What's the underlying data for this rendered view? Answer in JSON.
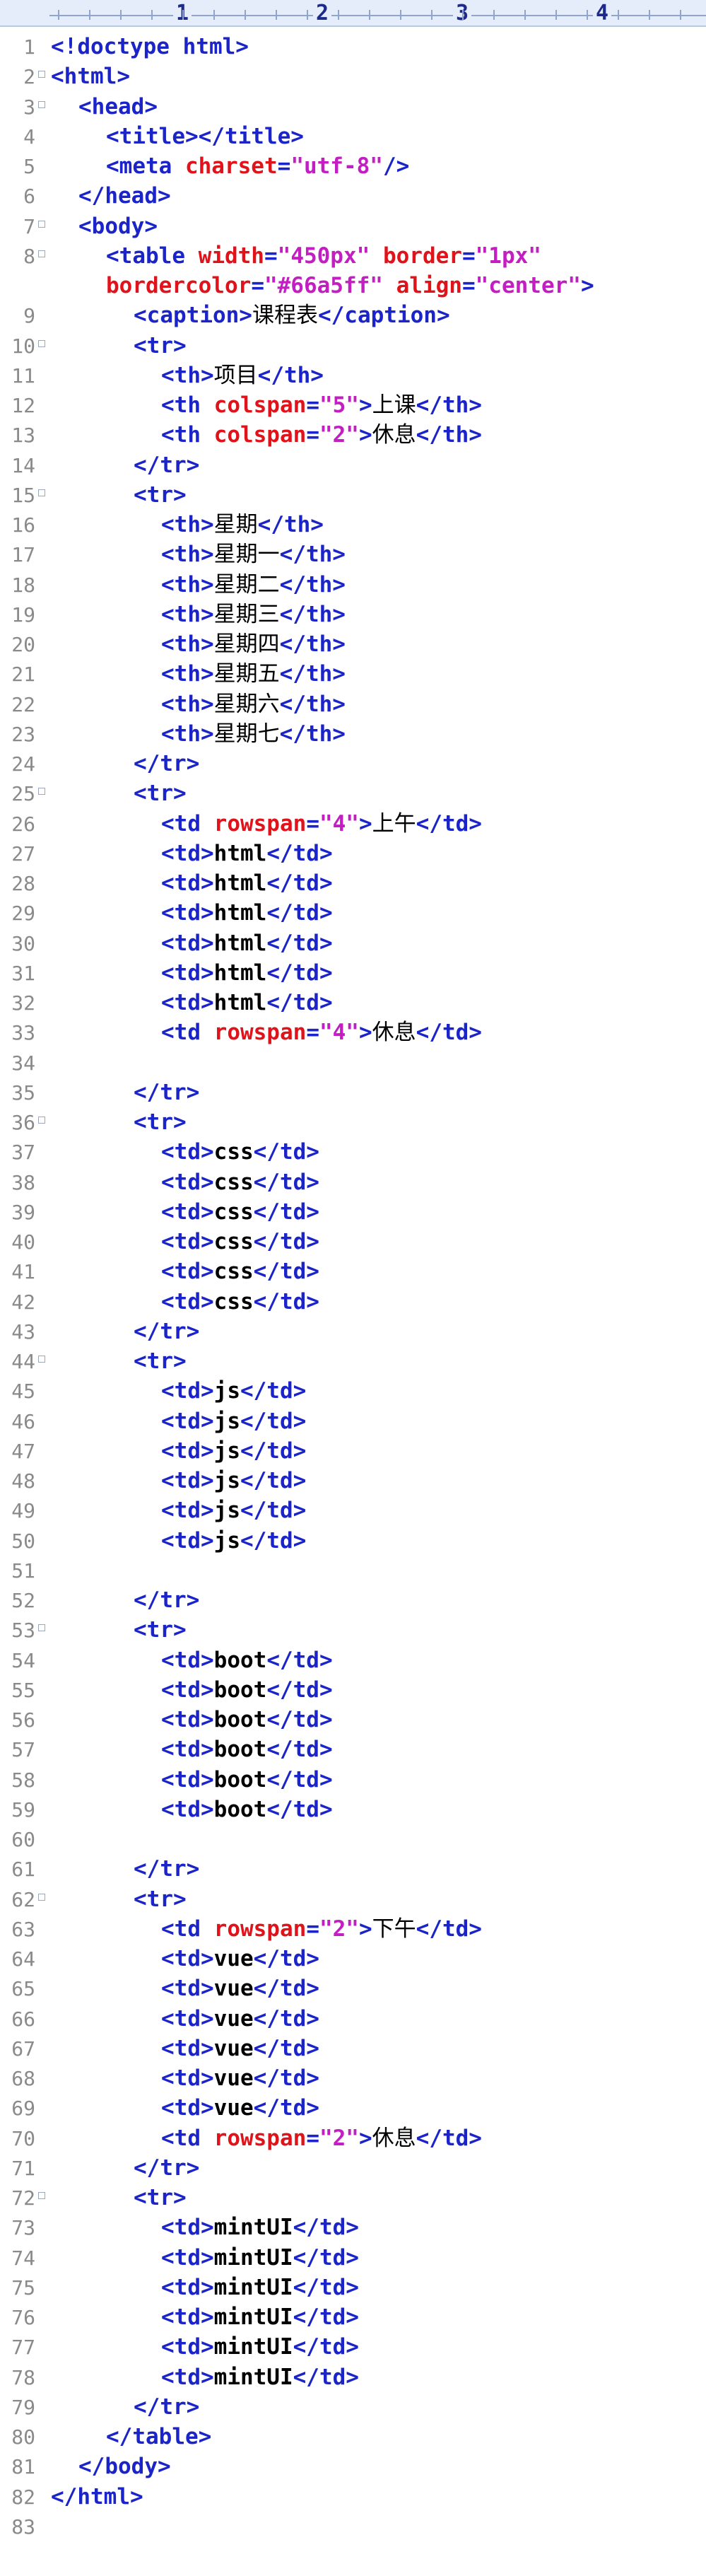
{
  "ruler": {
    "numbers": [
      "1",
      "2",
      "3",
      "4"
    ]
  },
  "lines": [
    {
      "n": "1",
      "indent": 0,
      "parts": [
        [
          "tag",
          "<!doctype "
        ],
        [
          "doc",
          "html"
        ],
        [
          "tag",
          ">"
        ]
      ]
    },
    {
      "n": "2",
      "indent": 0,
      "fold": true,
      "parts": [
        [
          "tag",
          "<html>"
        ]
      ]
    },
    {
      "n": "3",
      "indent": 1,
      "fold": true,
      "parts": [
        [
          "tag",
          "<head>"
        ]
      ]
    },
    {
      "n": "4",
      "indent": 2,
      "parts": [
        [
          "tag",
          "<title></title>"
        ]
      ]
    },
    {
      "n": "5",
      "indent": 2,
      "parts": [
        [
          "tag",
          "<meta "
        ],
        [
          "attr",
          "charset"
        ],
        [
          "tag",
          "="
        ],
        [
          "val",
          "\"utf-8\""
        ],
        [
          "tag",
          "/>"
        ]
      ]
    },
    {
      "n": "6",
      "indent": 1,
      "parts": [
        [
          "tag",
          "</head>"
        ]
      ]
    },
    {
      "n": "7",
      "indent": 1,
      "fold": true,
      "parts": [
        [
          "tag",
          "<body>"
        ]
      ]
    },
    {
      "n": "8",
      "indent": 2,
      "fold": true,
      "parts": [
        [
          "tag",
          "<table "
        ],
        [
          "attr",
          "width"
        ],
        [
          "tag",
          "="
        ],
        [
          "val",
          "\"450px\""
        ],
        [
          "tag",
          " "
        ],
        [
          "attr",
          "border"
        ],
        [
          "tag",
          "="
        ],
        [
          "val",
          "\"1px\""
        ]
      ]
    },
    {
      "n": "",
      "indent": 2,
      "parts": [
        [
          "attr",
          "bordercolor"
        ],
        [
          "tag",
          "="
        ],
        [
          "val",
          "\"#66a5ff\""
        ],
        [
          "tag",
          " "
        ],
        [
          "attr",
          "align"
        ],
        [
          "tag",
          "="
        ],
        [
          "val",
          "\"center\""
        ],
        [
          "tag",
          ">"
        ]
      ]
    },
    {
      "n": "9",
      "indent": 3,
      "parts": [
        [
          "tag",
          "<caption>"
        ],
        [
          "txt",
          "课程表"
        ],
        [
          "tag",
          "</caption>"
        ]
      ]
    },
    {
      "n": "10",
      "indent": 3,
      "fold": true,
      "parts": [
        [
          "tag",
          "<tr>"
        ]
      ]
    },
    {
      "n": "11",
      "indent": 4,
      "parts": [
        [
          "tag",
          "<th>"
        ],
        [
          "txt",
          "项目"
        ],
        [
          "tag",
          "</th>"
        ]
      ]
    },
    {
      "n": "12",
      "indent": 4,
      "parts": [
        [
          "tag",
          "<th "
        ],
        [
          "attr",
          "colspan"
        ],
        [
          "tag",
          "="
        ],
        [
          "val",
          "\"5\""
        ],
        [
          "tag",
          ">"
        ],
        [
          "txt",
          "上课"
        ],
        [
          "tag",
          "</th>"
        ]
      ]
    },
    {
      "n": "13",
      "indent": 4,
      "parts": [
        [
          "tag",
          "<th "
        ],
        [
          "attr",
          "colspan"
        ],
        [
          "tag",
          "="
        ],
        [
          "val",
          "\"2\""
        ],
        [
          "tag",
          ">"
        ],
        [
          "txt",
          "休息"
        ],
        [
          "tag",
          "</th>"
        ]
      ]
    },
    {
      "n": "14",
      "indent": 3,
      "parts": [
        [
          "tag",
          "</tr>"
        ]
      ]
    },
    {
      "n": "15",
      "indent": 3,
      "fold": true,
      "parts": [
        [
          "tag",
          "<tr>"
        ]
      ]
    },
    {
      "n": "16",
      "indent": 4,
      "parts": [
        [
          "tag",
          "<th>"
        ],
        [
          "txt",
          "星期"
        ],
        [
          "tag",
          "</th>"
        ]
      ]
    },
    {
      "n": "17",
      "indent": 4,
      "parts": [
        [
          "tag",
          "<th>"
        ],
        [
          "txt",
          "星期一"
        ],
        [
          "tag",
          "</th>"
        ]
      ]
    },
    {
      "n": "18",
      "indent": 4,
      "parts": [
        [
          "tag",
          "<th>"
        ],
        [
          "txt",
          "星期二"
        ],
        [
          "tag",
          "</th>"
        ]
      ]
    },
    {
      "n": "19",
      "indent": 4,
      "parts": [
        [
          "tag",
          "<th>"
        ],
        [
          "txt",
          "星期三"
        ],
        [
          "tag",
          "</th>"
        ]
      ]
    },
    {
      "n": "20",
      "indent": 4,
      "parts": [
        [
          "tag",
          "<th>"
        ],
        [
          "txt",
          "星期四"
        ],
        [
          "tag",
          "</th>"
        ]
      ]
    },
    {
      "n": "21",
      "indent": 4,
      "parts": [
        [
          "tag",
          "<th>"
        ],
        [
          "txt",
          "星期五"
        ],
        [
          "tag",
          "</th>"
        ]
      ]
    },
    {
      "n": "22",
      "indent": 4,
      "parts": [
        [
          "tag",
          "<th>"
        ],
        [
          "txt",
          "星期六"
        ],
        [
          "tag",
          "</th>"
        ]
      ]
    },
    {
      "n": "23",
      "indent": 4,
      "parts": [
        [
          "tag",
          "<th>"
        ],
        [
          "txt",
          "星期七"
        ],
        [
          "tag",
          "</th>"
        ]
      ]
    },
    {
      "n": "24",
      "indent": 3,
      "parts": [
        [
          "tag",
          "</tr>"
        ]
      ]
    },
    {
      "n": "25",
      "indent": 3,
      "fold": true,
      "parts": [
        [
          "tag",
          "<tr>"
        ]
      ]
    },
    {
      "n": "26",
      "indent": 4,
      "parts": [
        [
          "tag",
          "<td "
        ],
        [
          "attr",
          "rowspan"
        ],
        [
          "tag",
          "="
        ],
        [
          "val",
          "\"4\""
        ],
        [
          "tag",
          ">"
        ],
        [
          "txt",
          "上午"
        ],
        [
          "tag",
          "</td>"
        ]
      ]
    },
    {
      "n": "27",
      "indent": 4,
      "parts": [
        [
          "tag",
          "<td>"
        ],
        [
          "txtm",
          "html"
        ],
        [
          "tag",
          "</td>"
        ]
      ]
    },
    {
      "n": "28",
      "indent": 4,
      "parts": [
        [
          "tag",
          "<td>"
        ],
        [
          "txtm",
          "html"
        ],
        [
          "tag",
          "</td>"
        ]
      ]
    },
    {
      "n": "29",
      "indent": 4,
      "parts": [
        [
          "tag",
          "<td>"
        ],
        [
          "txtm",
          "html"
        ],
        [
          "tag",
          "</td>"
        ]
      ]
    },
    {
      "n": "30",
      "indent": 4,
      "parts": [
        [
          "tag",
          "<td>"
        ],
        [
          "txtm",
          "html"
        ],
        [
          "tag",
          "</td>"
        ]
      ]
    },
    {
      "n": "31",
      "indent": 4,
      "parts": [
        [
          "tag",
          "<td>"
        ],
        [
          "txtm",
          "html"
        ],
        [
          "tag",
          "</td>"
        ]
      ]
    },
    {
      "n": "32",
      "indent": 4,
      "parts": [
        [
          "tag",
          "<td>"
        ],
        [
          "txtm",
          "html"
        ],
        [
          "tag",
          "</td>"
        ]
      ]
    },
    {
      "n": "33",
      "indent": 4,
      "parts": [
        [
          "tag",
          "<td "
        ],
        [
          "attr",
          "rowspan"
        ],
        [
          "tag",
          "="
        ],
        [
          "val",
          "\"4\""
        ],
        [
          "tag",
          ">"
        ],
        [
          "txt",
          "休息"
        ],
        [
          "tag",
          "</td>"
        ]
      ]
    },
    {
      "n": "34",
      "indent": 0,
      "parts": []
    },
    {
      "n": "35",
      "indent": 3,
      "parts": [
        [
          "tag",
          "</tr>"
        ]
      ]
    },
    {
      "n": "36",
      "indent": 3,
      "fold": true,
      "parts": [
        [
          "tag",
          "<tr>"
        ]
      ]
    },
    {
      "n": "37",
      "indent": 4,
      "parts": [
        [
          "tag",
          "<td>"
        ],
        [
          "txtm",
          "css"
        ],
        [
          "tag",
          "</td>"
        ]
      ]
    },
    {
      "n": "38",
      "indent": 4,
      "parts": [
        [
          "tag",
          "<td>"
        ],
        [
          "txtm",
          "css"
        ],
        [
          "tag",
          "</td>"
        ]
      ]
    },
    {
      "n": "39",
      "indent": 4,
      "parts": [
        [
          "tag",
          "<td>"
        ],
        [
          "txtm",
          "css"
        ],
        [
          "tag",
          "</td>"
        ]
      ]
    },
    {
      "n": "40",
      "indent": 4,
      "parts": [
        [
          "tag",
          "<td>"
        ],
        [
          "txtm",
          "css"
        ],
        [
          "tag",
          "</td>"
        ]
      ]
    },
    {
      "n": "41",
      "indent": 4,
      "parts": [
        [
          "tag",
          "<td>"
        ],
        [
          "txtm",
          "css"
        ],
        [
          "tag",
          "</td>"
        ]
      ]
    },
    {
      "n": "42",
      "indent": 4,
      "parts": [
        [
          "tag",
          "<td>"
        ],
        [
          "txtm",
          "css"
        ],
        [
          "tag",
          "</td>"
        ]
      ]
    },
    {
      "n": "43",
      "indent": 3,
      "parts": [
        [
          "tag",
          "</tr>"
        ]
      ]
    },
    {
      "n": "44",
      "indent": 3,
      "fold": true,
      "parts": [
        [
          "tag",
          "<tr>"
        ]
      ]
    },
    {
      "n": "45",
      "indent": 4,
      "parts": [
        [
          "tag",
          "<td>"
        ],
        [
          "txtm",
          "js"
        ],
        [
          "tag",
          "</td>"
        ]
      ]
    },
    {
      "n": "46",
      "indent": 4,
      "parts": [
        [
          "tag",
          "<td>"
        ],
        [
          "txtm",
          "js"
        ],
        [
          "tag",
          "</td>"
        ]
      ]
    },
    {
      "n": "47",
      "indent": 4,
      "parts": [
        [
          "tag",
          "<td>"
        ],
        [
          "txtm",
          "js"
        ],
        [
          "tag",
          "</td>"
        ]
      ]
    },
    {
      "n": "48",
      "indent": 4,
      "parts": [
        [
          "tag",
          "<td>"
        ],
        [
          "txtm",
          "js"
        ],
        [
          "tag",
          "</td>"
        ]
      ]
    },
    {
      "n": "49",
      "indent": 4,
      "parts": [
        [
          "tag",
          "<td>"
        ],
        [
          "txtm",
          "js"
        ],
        [
          "tag",
          "</td>"
        ]
      ]
    },
    {
      "n": "50",
      "indent": 4,
      "parts": [
        [
          "tag",
          "<td>"
        ],
        [
          "txtm",
          "js"
        ],
        [
          "tag",
          "</td>"
        ]
      ]
    },
    {
      "n": "51",
      "indent": 0,
      "parts": []
    },
    {
      "n": "52",
      "indent": 3,
      "parts": [
        [
          "tag",
          "</tr>"
        ]
      ]
    },
    {
      "n": "53",
      "indent": 3,
      "fold": true,
      "parts": [
        [
          "tag",
          "<tr>"
        ]
      ]
    },
    {
      "n": "54",
      "indent": 4,
      "parts": [
        [
          "tag",
          "<td>"
        ],
        [
          "txtm",
          "boot"
        ],
        [
          "tag",
          "</td>"
        ]
      ]
    },
    {
      "n": "55",
      "indent": 4,
      "parts": [
        [
          "tag",
          "<td>"
        ],
        [
          "txtm",
          "boot"
        ],
        [
          "tag",
          "</td>"
        ]
      ]
    },
    {
      "n": "56",
      "indent": 4,
      "parts": [
        [
          "tag",
          "<td>"
        ],
        [
          "txtm",
          "boot"
        ],
        [
          "tag",
          "</td>"
        ]
      ]
    },
    {
      "n": "57",
      "indent": 4,
      "parts": [
        [
          "tag",
          "<td>"
        ],
        [
          "txtm",
          "boot"
        ],
        [
          "tag",
          "</td>"
        ]
      ]
    },
    {
      "n": "58",
      "indent": 4,
      "parts": [
        [
          "tag",
          "<td>"
        ],
        [
          "txtm",
          "boot"
        ],
        [
          "tag",
          "</td>"
        ]
      ]
    },
    {
      "n": "59",
      "indent": 4,
      "parts": [
        [
          "tag",
          "<td>"
        ],
        [
          "txtm",
          "boot"
        ],
        [
          "tag",
          "</td>"
        ]
      ]
    },
    {
      "n": "60",
      "indent": 0,
      "parts": []
    },
    {
      "n": "61",
      "indent": 3,
      "parts": [
        [
          "tag",
          "</tr>"
        ]
      ]
    },
    {
      "n": "62",
      "indent": 3,
      "fold": true,
      "parts": [
        [
          "tag",
          "<tr>"
        ]
      ]
    },
    {
      "n": "63",
      "indent": 4,
      "parts": [
        [
          "tag",
          "<td "
        ],
        [
          "attr",
          "rowspan"
        ],
        [
          "tag",
          "="
        ],
        [
          "val",
          "\"2\""
        ],
        [
          "tag",
          ">"
        ],
        [
          "txt",
          "下午"
        ],
        [
          "tag",
          "</td>"
        ]
      ]
    },
    {
      "n": "64",
      "indent": 4,
      "parts": [
        [
          "tag",
          "<td>"
        ],
        [
          "txtm",
          "vue"
        ],
        [
          "tag",
          "</td>"
        ]
      ]
    },
    {
      "n": "65",
      "indent": 4,
      "parts": [
        [
          "tag",
          "<td>"
        ],
        [
          "txtm",
          "vue"
        ],
        [
          "tag",
          "</td>"
        ]
      ]
    },
    {
      "n": "66",
      "indent": 4,
      "parts": [
        [
          "tag",
          "<td>"
        ],
        [
          "txtm",
          "vue"
        ],
        [
          "tag",
          "</td>"
        ]
      ]
    },
    {
      "n": "67",
      "indent": 4,
      "parts": [
        [
          "tag",
          "<td>"
        ],
        [
          "txtm",
          "vue"
        ],
        [
          "tag",
          "</td>"
        ]
      ]
    },
    {
      "n": "68",
      "indent": 4,
      "parts": [
        [
          "tag",
          "<td>"
        ],
        [
          "txtm",
          "vue"
        ],
        [
          "tag",
          "</td>"
        ]
      ]
    },
    {
      "n": "69",
      "indent": 4,
      "parts": [
        [
          "tag",
          "<td>"
        ],
        [
          "txtm",
          "vue"
        ],
        [
          "tag",
          "</td>"
        ]
      ]
    },
    {
      "n": "70",
      "indent": 4,
      "parts": [
        [
          "tag",
          "<td "
        ],
        [
          "attr",
          "rowspan"
        ],
        [
          "tag",
          "="
        ],
        [
          "val",
          "\"2\""
        ],
        [
          "tag",
          ">"
        ],
        [
          "txt",
          "休息"
        ],
        [
          "tag",
          "</td>"
        ]
      ]
    },
    {
      "n": "71",
      "indent": 3,
      "parts": [
        [
          "tag",
          "</tr>"
        ]
      ]
    },
    {
      "n": "72",
      "indent": 3,
      "fold": true,
      "parts": [
        [
          "tag",
          "<tr>"
        ]
      ]
    },
    {
      "n": "73",
      "indent": 4,
      "parts": [
        [
          "tag",
          "<td>"
        ],
        [
          "txtm",
          "mintUI"
        ],
        [
          "tag",
          "</td>"
        ]
      ]
    },
    {
      "n": "74",
      "indent": 4,
      "parts": [
        [
          "tag",
          "<td>"
        ],
        [
          "txtm",
          "mintUI"
        ],
        [
          "tag",
          "</td>"
        ]
      ]
    },
    {
      "n": "75",
      "indent": 4,
      "parts": [
        [
          "tag",
          "<td>"
        ],
        [
          "txtm",
          "mintUI"
        ],
        [
          "tag",
          "</td>"
        ]
      ]
    },
    {
      "n": "76",
      "indent": 4,
      "parts": [
        [
          "tag",
          "<td>"
        ],
        [
          "txtm",
          "mintUI"
        ],
        [
          "tag",
          "</td>"
        ]
      ]
    },
    {
      "n": "77",
      "indent": 4,
      "parts": [
        [
          "tag",
          "<td>"
        ],
        [
          "txtm",
          "mintUI"
        ],
        [
          "tag",
          "</td>"
        ]
      ]
    },
    {
      "n": "78",
      "indent": 4,
      "parts": [
        [
          "tag",
          "<td>"
        ],
        [
          "txtm",
          "mintUI"
        ],
        [
          "tag",
          "</td>"
        ]
      ]
    },
    {
      "n": "79",
      "indent": 3,
      "parts": [
        [
          "tag",
          "</tr>"
        ]
      ]
    },
    {
      "n": "80",
      "indent": 2,
      "parts": [
        [
          "tag",
          "</table>"
        ]
      ]
    },
    {
      "n": "81",
      "indent": 1,
      "parts": [
        [
          "tag",
          "</body>"
        ]
      ]
    },
    {
      "n": "82",
      "indent": 0,
      "parts": [
        [
          "tag",
          "</html>"
        ]
      ]
    },
    {
      "n": "83",
      "indent": 0,
      "parts": []
    }
  ]
}
